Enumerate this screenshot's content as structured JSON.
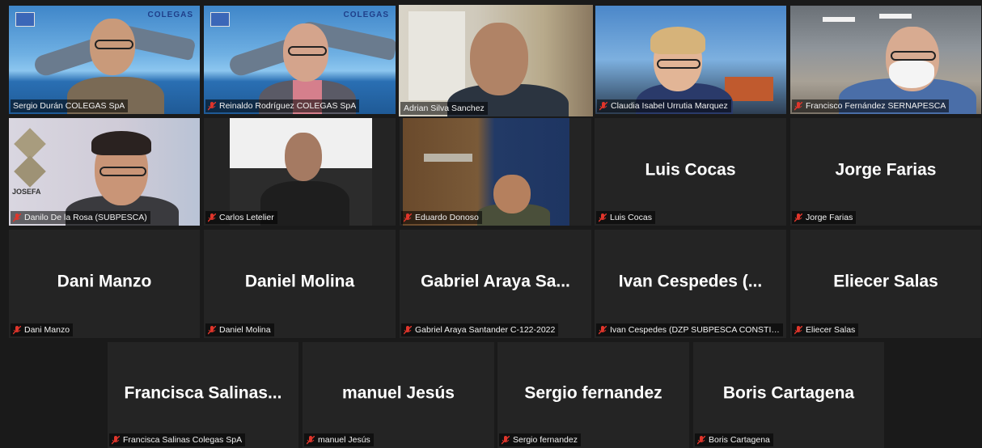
{
  "participants": [
    {
      "id": "p1",
      "label": "Sergio Durán COLEGAS SpA",
      "muted": false,
      "video": true,
      "logo": "COLEGAS"
    },
    {
      "id": "p2",
      "label": "Reinaldo Rodríguez  COLEGAS SpA",
      "muted": true,
      "video": true,
      "logo": "COLEGAS"
    },
    {
      "id": "p3",
      "label": "Adrian Silva Sanchez",
      "muted": false,
      "video": true,
      "active": true
    },
    {
      "id": "p4",
      "label": "Claudia Isabel Urrutia Marquez",
      "muted": true,
      "video": true
    },
    {
      "id": "p5",
      "label": "Francisco Fernández SERNAPESCA",
      "muted": true,
      "video": true
    },
    {
      "id": "p6",
      "label": "Danilo De la Rosa (SUBPESCA)",
      "muted": true,
      "video": true,
      "wall_text": "JOSEFA"
    },
    {
      "id": "p7",
      "label": "Carlos Letelier",
      "muted": true,
      "video": true
    },
    {
      "id": "p8",
      "label": "Eduardo Donoso",
      "muted": true,
      "video": true
    },
    {
      "id": "p9",
      "display": "Luis Cocas",
      "label": "Luis Cocas",
      "muted": true,
      "video": false
    },
    {
      "id": "p10",
      "display": "Jorge Farias",
      "label": "Jorge Farias",
      "muted": true,
      "video": false
    },
    {
      "id": "p11",
      "display": "Dani Manzo",
      "label": "Dani Manzo",
      "muted": true,
      "video": false
    },
    {
      "id": "p12",
      "display": "Daniel Molina",
      "label": "Daniel Molina",
      "muted": true,
      "video": false
    },
    {
      "id": "p13",
      "display": "Gabriel  Araya  Sa...",
      "label": "Gabriel Araya Santander C-122-2022",
      "muted": true,
      "video": false
    },
    {
      "id": "p14",
      "display": "Ivan  Cespedes  (...",
      "label": "Ivan Cespedes (DZP SUBPESCA CONSTITU...",
      "muted": true,
      "video": false
    },
    {
      "id": "p15",
      "display": "Eliecer Salas",
      "label": "Eliecer Salas",
      "muted": true,
      "video": false
    },
    {
      "id": "p16",
      "display": "Francisca  Salinas...",
      "label": "Francisca Salinas Colegas SpA",
      "muted": true,
      "video": false
    },
    {
      "id": "p17",
      "display": "manuel Jesús",
      "label": "manuel Jesús",
      "muted": true,
      "video": false
    },
    {
      "id": "p18",
      "display": "Sergio fernandez",
      "label": "Sergio fernandez",
      "muted": true,
      "video": false
    },
    {
      "id": "p19",
      "display": "Boris Cartagena",
      "label": "Boris Cartagena",
      "muted": true,
      "video": false
    }
  ],
  "colors": {
    "active_border": "#9bd43b",
    "muted_icon": "#e0352b",
    "tile_bg": "#242424",
    "page_bg": "#1a1a1a"
  }
}
